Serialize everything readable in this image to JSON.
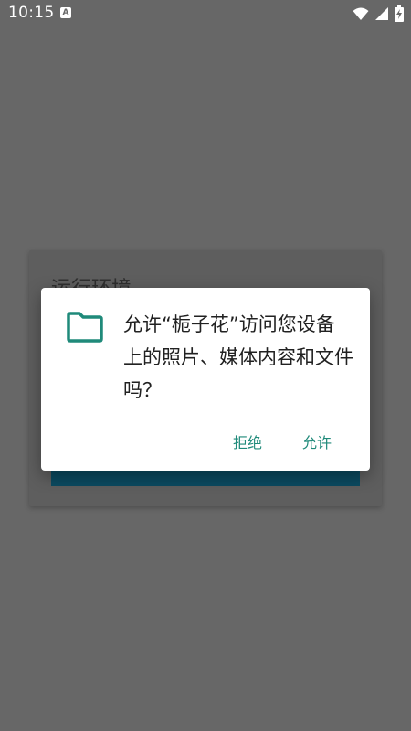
{
  "status_bar": {
    "time": "10:15",
    "notification_icon_letter": "A",
    "icons": [
      "wifi-icon",
      "signal-icon",
      "battery-charging-icon"
    ]
  },
  "background_card": {
    "title": "运行环境"
  },
  "dialog": {
    "message": "允许“栀子花”访问您设备上的照片、媒体内容和文件吗？",
    "icon": "folder-icon",
    "deny_label": "拒绝",
    "allow_label": "允许"
  },
  "colors": {
    "scrim": "#676767",
    "accent": "#1f8a7a",
    "card_bar": "#0b4a60",
    "dialog_bg": "#ffffff"
  }
}
